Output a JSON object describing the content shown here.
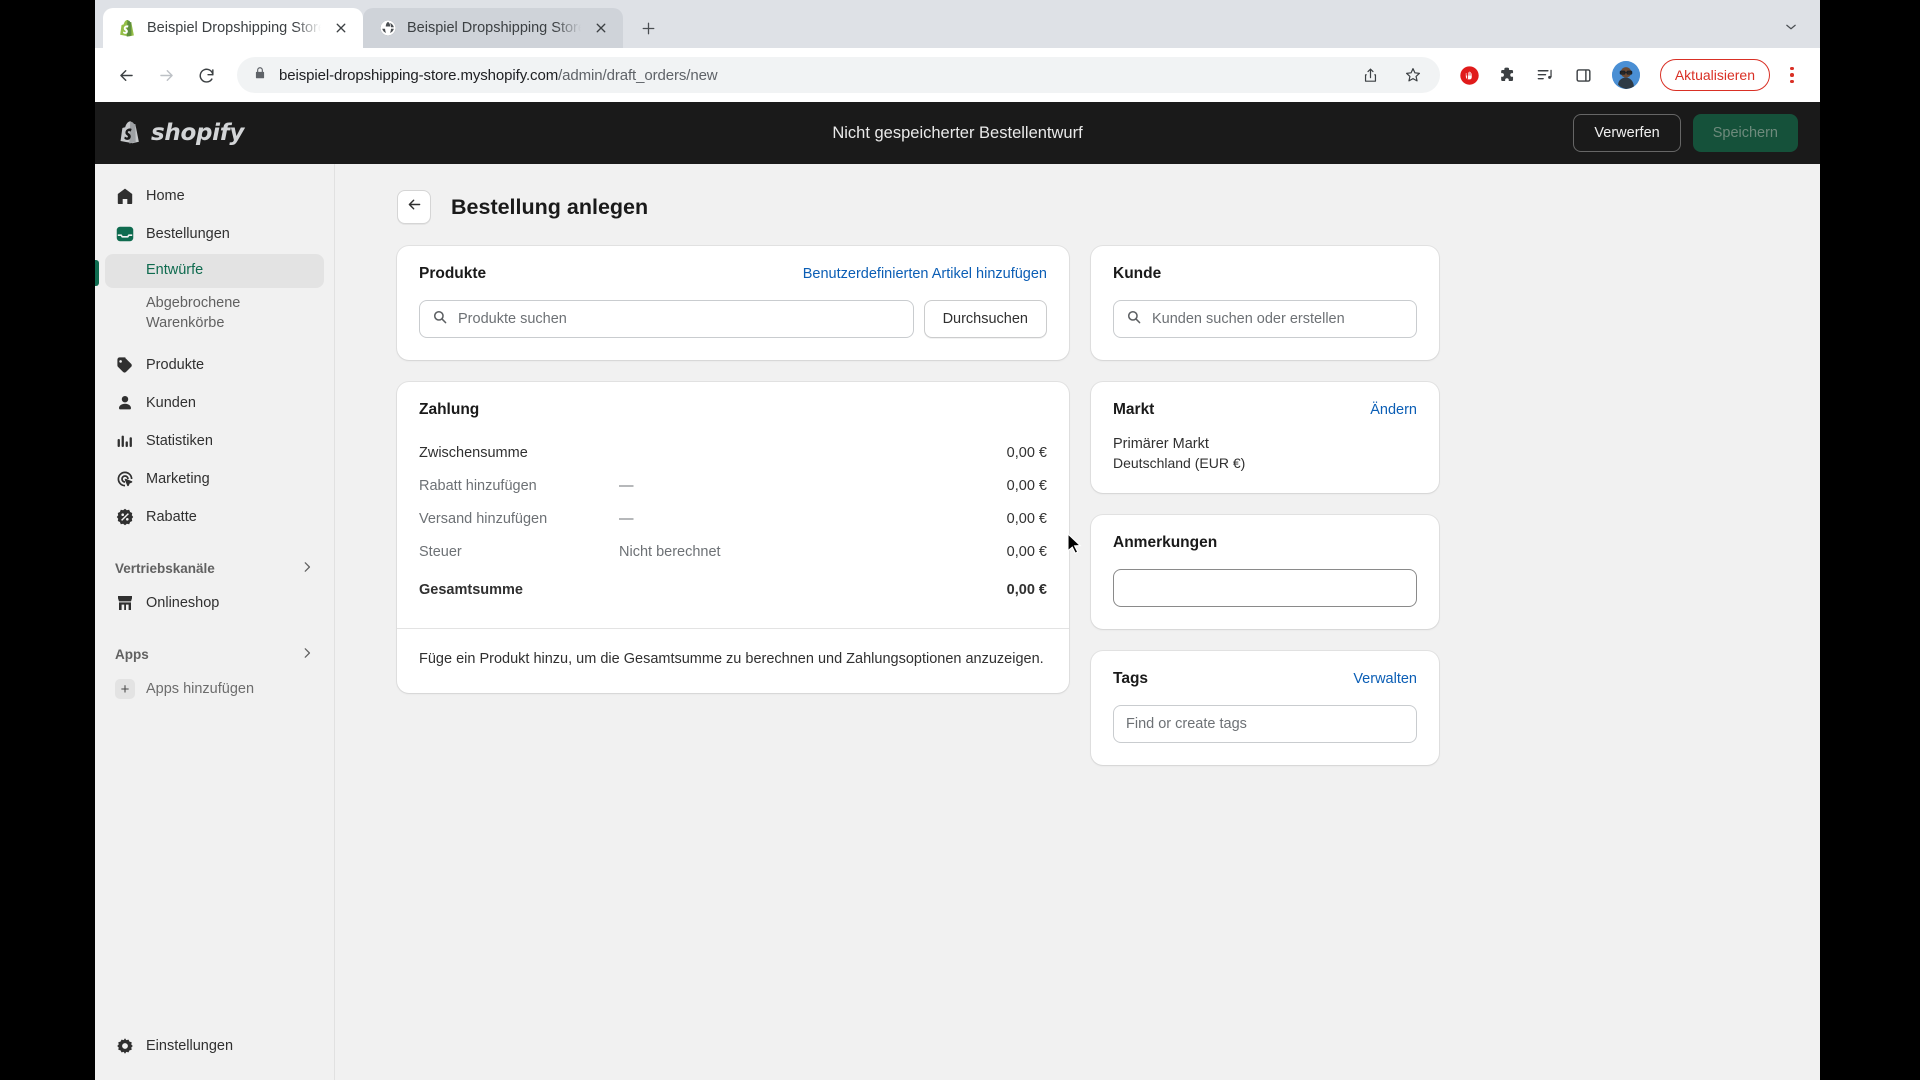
{
  "browser": {
    "tabs": [
      {
        "title": "Beispiel Dropshipping Store · E",
        "favicon": "shopify-bag-icon",
        "active": true
      },
      {
        "title": "Beispiel Dropshipping Store",
        "favicon": "globe-icon",
        "active": false
      }
    ],
    "new_tab_label": "+",
    "nav": {
      "back": "←",
      "forward": "→",
      "reload": "⟳"
    },
    "url_domain": "beispiel-dropshipping-store.myshopify.com",
    "url_path": "/admin/draft_orders/new",
    "toolbar_icons": [
      "share-icon",
      "bookmark-star-icon",
      "adblock-icon",
      "extensions-puzzle-icon",
      "media-playlist-icon",
      "side-panel-icon"
    ],
    "update_button": "Aktualisieren"
  },
  "topbar": {
    "logo_text": "shopify",
    "draft_title": "Nicht gespeicherter Bestellentwurf",
    "discard_label": "Verwerfen",
    "save_label": "Speichern"
  },
  "sidebar": {
    "items": [
      {
        "label": "Home",
        "icon": "home-icon"
      },
      {
        "label": "Bestellungen",
        "icon": "orders-inbox-icon"
      },
      {
        "label": "Produkte",
        "icon": "product-tag-icon"
      },
      {
        "label": "Kunden",
        "icon": "customer-person-icon"
      },
      {
        "label": "Statistiken",
        "icon": "analytics-bars-icon"
      },
      {
        "label": "Marketing",
        "icon": "marketing-target-icon"
      },
      {
        "label": "Rabatte",
        "icon": "discount-badge-icon"
      }
    ],
    "sub_items": [
      {
        "label": "Entwürfe",
        "active": true
      },
      {
        "label": "Abgebrochene Warenkörbe",
        "active": false
      }
    ],
    "sections": [
      {
        "label": "Vertriebskanäle",
        "icon": "chevron-right-icon"
      },
      {
        "label": "Apps",
        "icon": "chevron-right-icon"
      }
    ],
    "online_store": {
      "label": "Onlineshop",
      "icon": "storefront-icon"
    },
    "add_apps": {
      "label": "Apps hinzufügen",
      "icon": "plus-icon"
    },
    "settings": {
      "label": "Einstellungen",
      "icon": "gear-icon"
    }
  },
  "page": {
    "title": "Bestellung anlegen",
    "back_icon": "arrow-left-icon"
  },
  "products_card": {
    "title": "Produkte",
    "add_custom_link": "Benutzerdefinierten Artikel hinzufügen",
    "search_placeholder": "Produkte suchen",
    "browse_button": "Durchsuchen"
  },
  "payment_card": {
    "title": "Zahlung",
    "rows": [
      {
        "label": "Zwischensumme",
        "middle": "",
        "amount": "0,00 €",
        "muted": false
      },
      {
        "label": "Rabatt hinzufügen",
        "middle": "—",
        "amount": "0,00 €",
        "muted": true
      },
      {
        "label": "Versand hinzufügen",
        "middle": "—",
        "amount": "0,00 €",
        "muted": true
      },
      {
        "label": "Steuer",
        "middle": "Nicht berechnet",
        "amount": "0,00 €",
        "muted": true
      }
    ],
    "total_label": "Gesamtsumme",
    "total_amount": "0,00 €",
    "footer_note": "Füge ein Produkt hinzu, um die Gesamtsumme zu berechnen und Zahlungsoptionen anzuzeigen."
  },
  "customer_card": {
    "title": "Kunde",
    "search_placeholder": "Kunden suchen oder erstellen"
  },
  "market_card": {
    "title": "Markt",
    "change_link": "Ändern",
    "primary_label": "Primärer Markt",
    "value": "Deutschland (EUR €)"
  },
  "notes_card": {
    "title": "Anmerkungen",
    "value": ""
  },
  "tags_card": {
    "title": "Tags",
    "manage_link": "Verwalten",
    "placeholder": "Find or create tags"
  },
  "colors": {
    "accent_green": "#0f6b4f",
    "link_blue": "#0b5eb5",
    "topbar_dark": "#1a1a1a",
    "page_bg": "#f1f1f1",
    "update_red": "#d93025"
  }
}
